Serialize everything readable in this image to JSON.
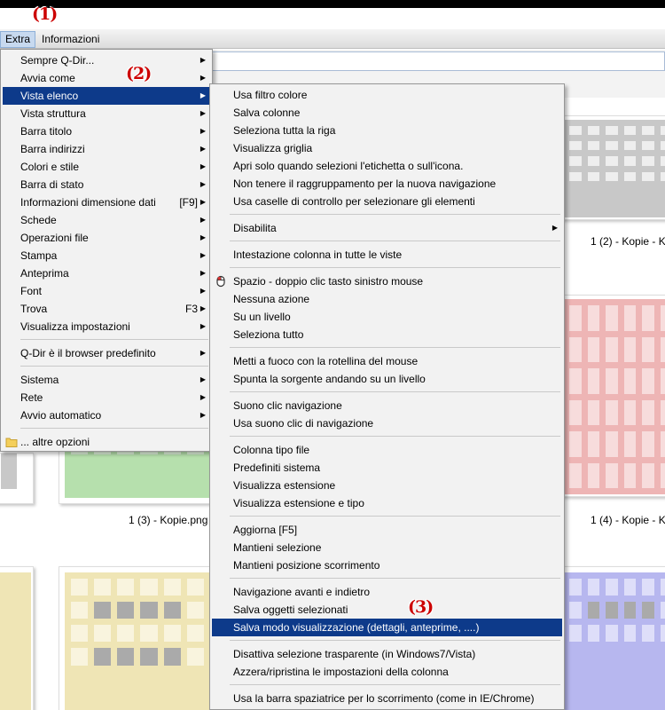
{
  "menubar": {
    "extra": "Extra",
    "informazioni": "Informazioni"
  },
  "markers": [
    "(1)",
    "(2)",
    "(3)"
  ],
  "thumbnails": [
    {
      "caption": "1 (2) - Kopie - K",
      "color": "#c8c8c8"
    },
    {
      "caption": "1 (3) - Kopie.png",
      "color": "#b6e0ad"
    },
    {
      "caption": "1 (4) - Kopie - K",
      "color": "#eeb5b5"
    }
  ],
  "menu_extra": [
    {
      "label": "Sempre Q-Dir...",
      "arrow": true
    },
    {
      "label": "Avvia come",
      "arrow": true
    },
    {
      "label": "Vista elenco",
      "arrow": true,
      "highlight": true
    },
    {
      "label": "Vista struttura",
      "arrow": true
    },
    {
      "label": "Barra titolo",
      "arrow": true
    },
    {
      "label": "Barra indirizzi",
      "arrow": true
    },
    {
      "label": "Colori e stile",
      "arrow": true
    },
    {
      "label": "Barra di stato",
      "arrow": true
    },
    {
      "label": "Informazioni dimensione dati",
      "shortcut": "[F9]",
      "arrow": true
    },
    {
      "label": "Schede",
      "arrow": true
    },
    {
      "label": "Operazioni file",
      "arrow": true
    },
    {
      "label": "Stampa",
      "arrow": true
    },
    {
      "label": "Anteprima",
      "arrow": true
    },
    {
      "label": "Font",
      "arrow": true
    },
    {
      "label": "Trova",
      "shortcut": "F3",
      "arrow": true
    },
    {
      "label": "Visualizza impostazioni",
      "arrow": true
    },
    {
      "separator": true
    },
    {
      "label": "Q-Dir è il browser predefinito",
      "arrow": true
    },
    {
      "separator": true
    },
    {
      "label": "Sistema",
      "arrow": true
    },
    {
      "label": "Rete",
      "arrow": true
    },
    {
      "label": "Avvio automatico",
      "arrow": true
    },
    {
      "separator": true
    },
    {
      "label": "... altre opzioni",
      "icon": "folder-icon"
    }
  ],
  "menu_vista": [
    {
      "label": "Usa filtro colore"
    },
    {
      "label": "Salva colonne"
    },
    {
      "label": "Seleziona tutta la riga"
    },
    {
      "label": "Visualizza griglia"
    },
    {
      "label": "Apri solo quando selezioni l'etichetta o sull'icona."
    },
    {
      "label": "Non tenere il raggruppamento per la nuova navigazione"
    },
    {
      "label": "Usa caselle di controllo per selezionare gli elementi"
    },
    {
      "separator": true
    },
    {
      "label": "Disabilita",
      "arrow": true
    },
    {
      "separator": true
    },
    {
      "label": "Intestazione colonna in tutte le viste"
    },
    {
      "separator": true
    },
    {
      "label": "Spazio - doppio clic tasto sinistro mouse",
      "icon": "mouse-icon"
    },
    {
      "label": "Nessuna azione"
    },
    {
      "label": "Su un livello"
    },
    {
      "label": "Seleziona tutto"
    },
    {
      "separator": true
    },
    {
      "label": "Metti a fuoco con la rotellina del mouse"
    },
    {
      "label": "Spunta la sorgente andando su un livello"
    },
    {
      "separator": true
    },
    {
      "label": "Suono clic navigazione"
    },
    {
      "label": "Usa suono clic di navigazione"
    },
    {
      "separator": true
    },
    {
      "label": "Colonna tipo file"
    },
    {
      "label": "Predefiniti sistema"
    },
    {
      "label": "Visualizza estensione"
    },
    {
      "label": "Visualizza estensione e tipo"
    },
    {
      "separator": true
    },
    {
      "label": "Aggiorna [F5]"
    },
    {
      "label": "Mantieni selezione"
    },
    {
      "label": "Mantieni posizione scorrimento"
    },
    {
      "separator": true
    },
    {
      "label": "Navigazione avanti e indietro"
    },
    {
      "label": "Salva oggetti selezionati"
    },
    {
      "label": "Salva modo visualizzazione (dettagli, anteprime, ....)",
      "highlight": true
    },
    {
      "separator": true
    },
    {
      "label": "Disattiva selezione trasparente (in Windows7/Vista)"
    },
    {
      "label": "Azzera/ripristina le impostazioni della colonna"
    },
    {
      "separator": true
    },
    {
      "label": "Usa la barra spaziatrice per lo scorrimento (come in IE/Chrome)"
    }
  ],
  "colors": {
    "highlight": "#0d3a8a",
    "marker": "#cc0000"
  }
}
